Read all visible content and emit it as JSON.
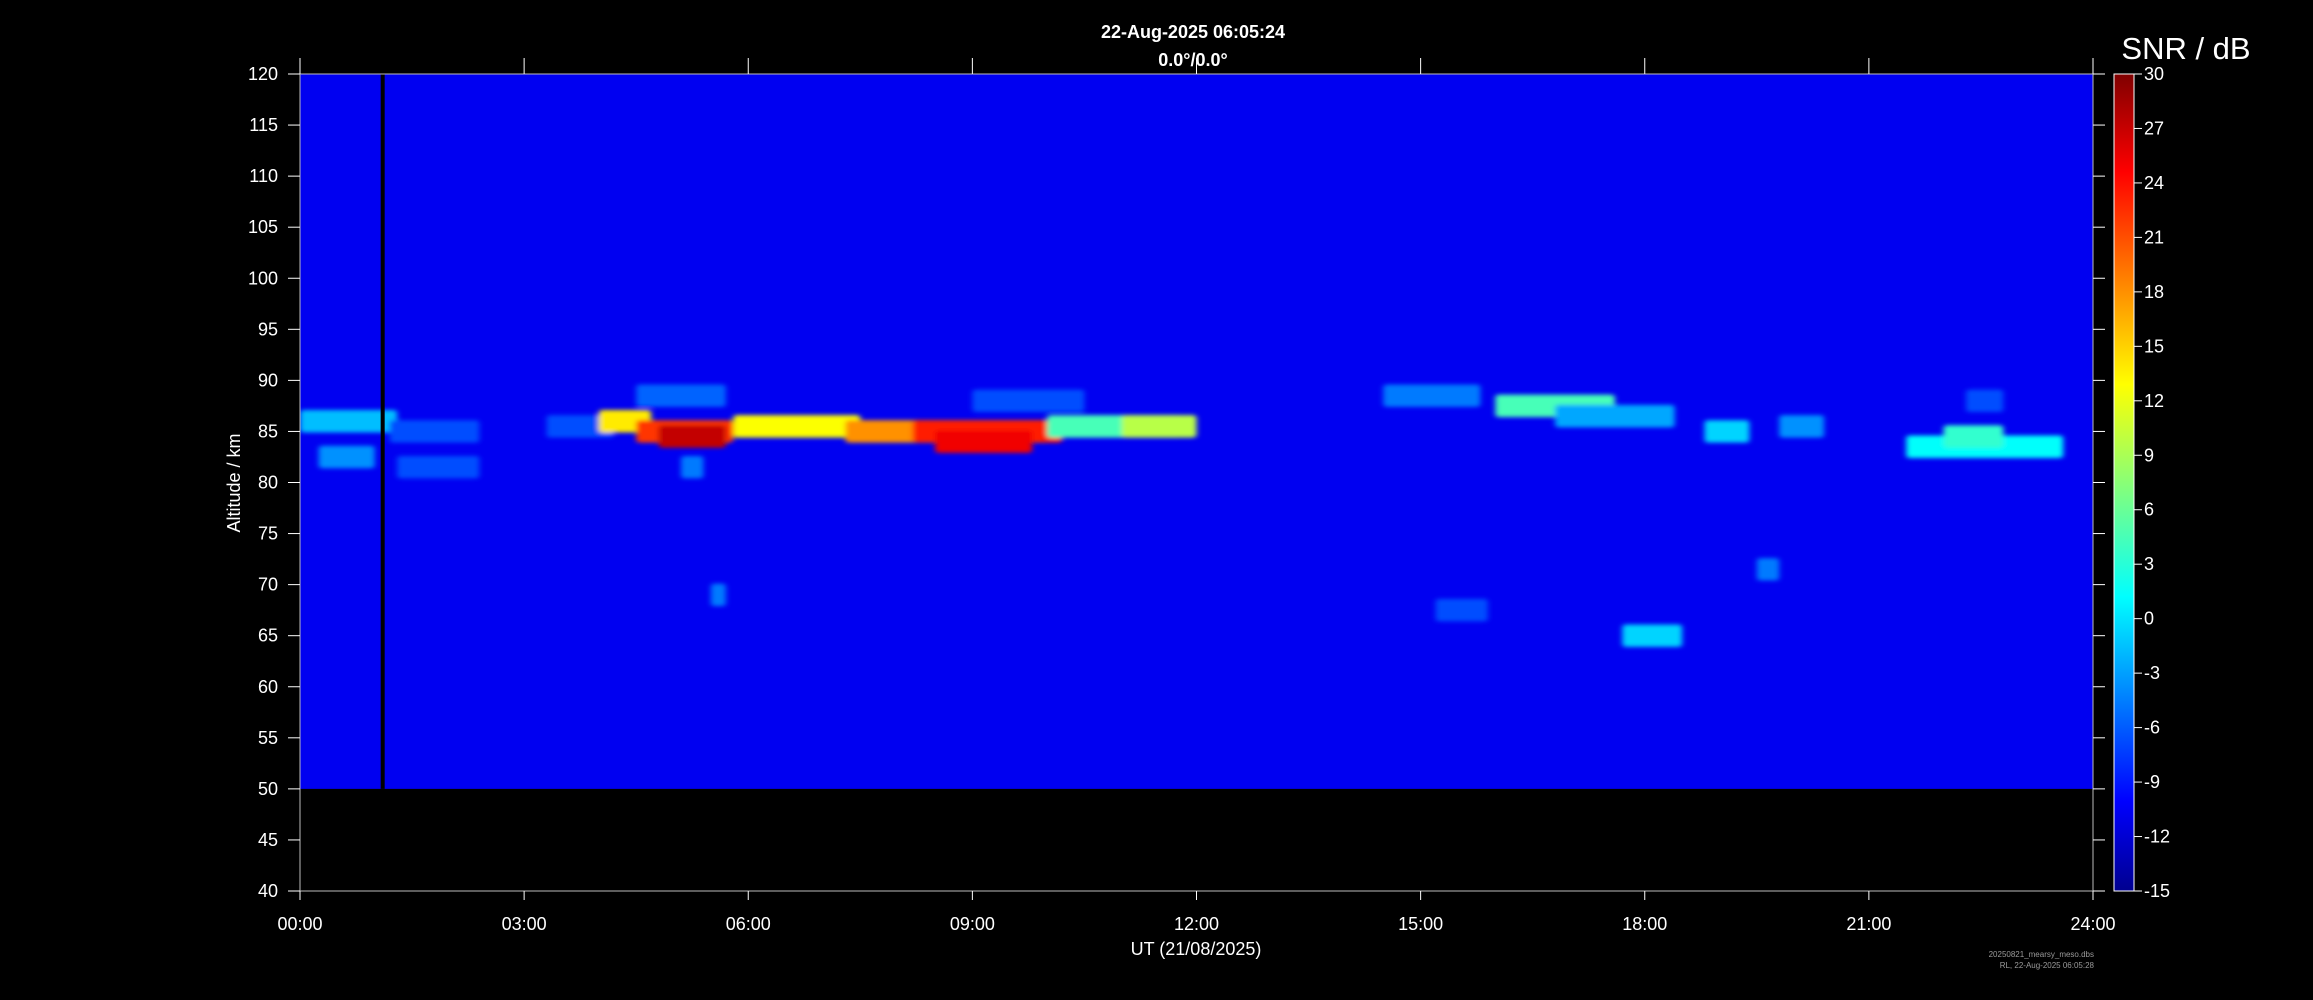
{
  "chart_data": {
    "type": "heatmap",
    "title": "22-Aug-2025 06:05:24",
    "subtitle": "0.0°/0.0°",
    "xlabel": "UT (21/08/2025)",
    "ylabel": "Altitude / km",
    "x_ticks": [
      "00:00",
      "03:00",
      "06:00",
      "09:00",
      "12:00",
      "15:00",
      "18:00",
      "21:00",
      "24:00"
    ],
    "x_range_hours": [
      0,
      24
    ],
    "y_ticks": [
      40,
      45,
      50,
      55,
      60,
      65,
      70,
      75,
      80,
      85,
      90,
      95,
      100,
      105,
      110,
      115,
      120
    ],
    "ylim": [
      40,
      120
    ],
    "data_altitude_range": [
      50,
      120
    ],
    "colorbar": {
      "label": "SNR / dB",
      "range": [
        -15,
        30
      ],
      "ticks": [
        30,
        27,
        24,
        21,
        18,
        15,
        12,
        9,
        6,
        3,
        0,
        -3,
        -6,
        -9,
        -12,
        -15
      ],
      "colormap": "jet"
    },
    "background_snr_db": -10,
    "data_gap_hours": [
      1.08,
      1.12
    ],
    "echo_features": [
      {
        "t0": 0.0,
        "t1": 1.3,
        "alt": 86.0,
        "snr": -1
      },
      {
        "t0": 0.25,
        "t1": 1.0,
        "alt": 82.5,
        "snr": -3
      },
      {
        "t0": 1.2,
        "t1": 2.4,
        "alt": 85.0,
        "snr": -6
      },
      {
        "t0": 1.3,
        "t1": 2.4,
        "alt": 81.5,
        "snr": -6
      },
      {
        "t0": 3.3,
        "t1": 4.2,
        "alt": 85.5,
        "snr": -6
      },
      {
        "t0": 4.0,
        "t1": 4.7,
        "alt": 86.0,
        "snr": 14
      },
      {
        "t0": 4.5,
        "t1": 5.8,
        "alt": 85.0,
        "snr": 22
      },
      {
        "t0": 4.8,
        "t1": 5.7,
        "alt": 84.5,
        "snr": 27
      },
      {
        "t0": 4.5,
        "t1": 5.7,
        "alt": 88.5,
        "snr": -5
      },
      {
        "t0": 5.1,
        "t1": 5.4,
        "alt": 81.5,
        "snr": -4
      },
      {
        "t0": 5.8,
        "t1": 7.5,
        "alt": 85.5,
        "snr": 13
      },
      {
        "t0": 7.3,
        "t1": 10.0,
        "alt": 85.0,
        "snr": 18
      },
      {
        "t0": 8.2,
        "t1": 10.2,
        "alt": 85.0,
        "snr": 23
      },
      {
        "t0": 8.5,
        "t1": 9.8,
        "alt": 84.0,
        "snr": 25
      },
      {
        "t0": 9.0,
        "t1": 10.5,
        "alt": 88.0,
        "snr": -6
      },
      {
        "t0": 10.0,
        "t1": 11.8,
        "alt": 85.5,
        "snr": 5
      },
      {
        "t0": 11.0,
        "t1": 12.0,
        "alt": 85.5,
        "snr": 10
      },
      {
        "t0": 14.5,
        "t1": 15.8,
        "alt": 88.5,
        "snr": -4
      },
      {
        "t0": 16.0,
        "t1": 17.6,
        "alt": 87.5,
        "snr": 5
      },
      {
        "t0": 16.8,
        "t1": 18.4,
        "alt": 86.5,
        "snr": -2
      },
      {
        "t0": 18.8,
        "t1": 19.4,
        "alt": 85.0,
        "snr": 0
      },
      {
        "t0": 19.8,
        "t1": 20.4,
        "alt": 85.5,
        "snr": -3
      },
      {
        "t0": 21.5,
        "t1": 23.6,
        "alt": 83.5,
        "snr": 2
      },
      {
        "t0": 22.0,
        "t1": 22.8,
        "alt": 84.5,
        "snr": 4
      },
      {
        "t0": 22.3,
        "t1": 22.8,
        "alt": 88.0,
        "snr": -6
      },
      {
        "t0": 15.2,
        "t1": 15.9,
        "alt": 67.5,
        "snr": -6
      },
      {
        "t0": 17.7,
        "t1": 18.5,
        "alt": 65.0,
        "snr": 0
      },
      {
        "t0": 19.5,
        "t1": 19.8,
        "alt": 71.5,
        "snr": -4
      },
      {
        "t0": 5.5,
        "t1": 5.7,
        "alt": 69.0,
        "snr": -4
      }
    ]
  },
  "footer": {
    "line1": "20250821_mearsy_meso.dbs",
    "line2": "RL, 22-Aug-2025 06:05:28"
  }
}
